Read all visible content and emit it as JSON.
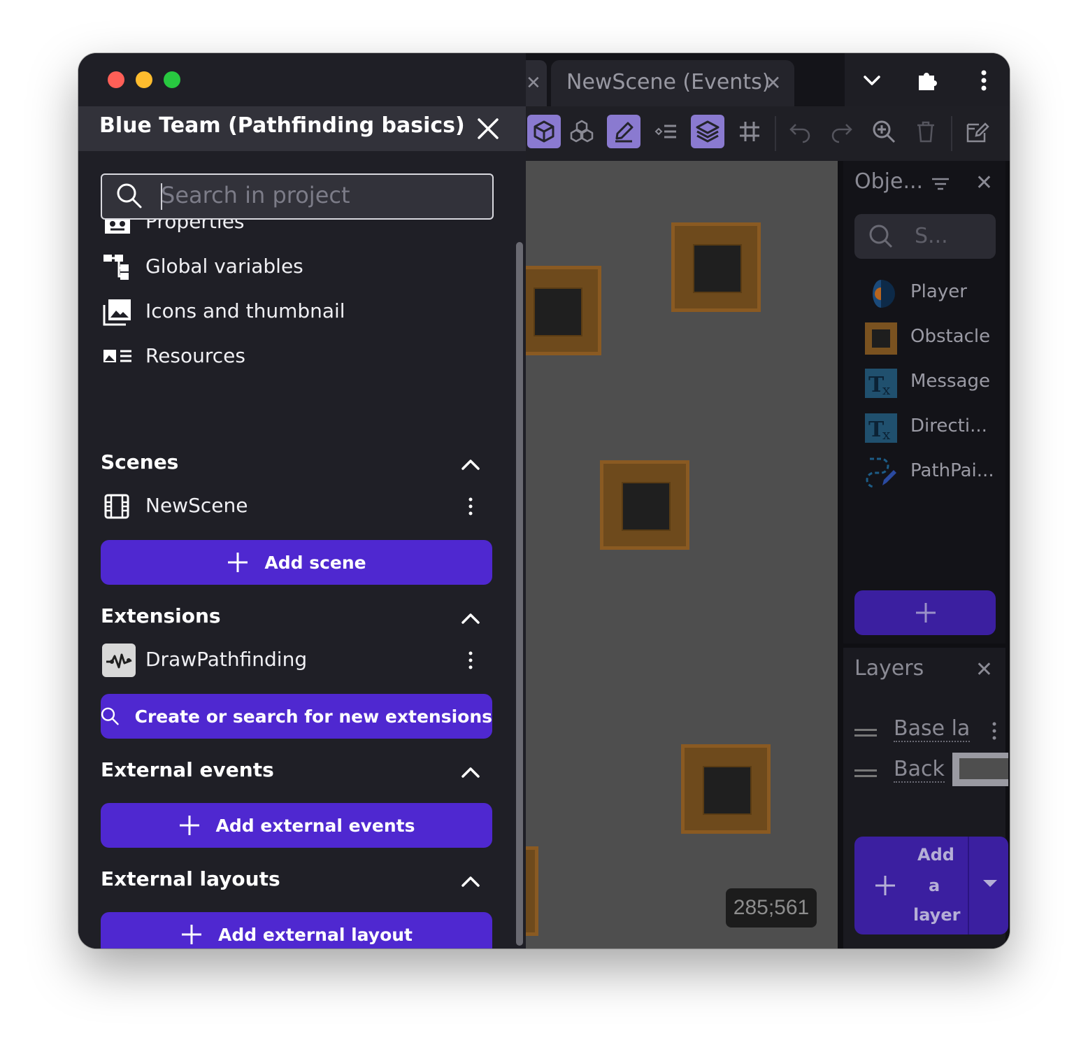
{
  "window": {
    "traffic_lights": {
      "close": "#ff5f57",
      "minimize": "#febc2e",
      "maximize": "#28c840"
    }
  },
  "editor": {
    "tab": {
      "label": "NewScene (Events)"
    },
    "coordinates": "285;561",
    "objects_panel": {
      "title": "Obje...",
      "search_placeholder": "S...",
      "items": [
        {
          "name": "Player",
          "icon": "player-sprite-icon"
        },
        {
          "name": "Obstacle",
          "icon": "crate-sprite-icon"
        },
        {
          "name": "Message",
          "icon": "text-object-icon"
        },
        {
          "name": "Directi...",
          "icon": "text-object-icon"
        },
        {
          "name": "PathPai...",
          "icon": "path-painter-icon"
        }
      ]
    },
    "layers_panel": {
      "title": "Layers",
      "layers": [
        {
          "name": "Base la"
        },
        {
          "name": "Back"
        }
      ],
      "add_layer_lines": [
        "Add",
        "a",
        "layer"
      ]
    }
  },
  "project_manager": {
    "title": "Blue Team (Pathfinding basics)",
    "search": {
      "placeholder": "Search in project"
    },
    "game_items": [
      {
        "label": "Properties",
        "icon": "properties-icon"
      },
      {
        "label": "Global variables",
        "icon": "variables-tree-icon"
      },
      {
        "label": "Icons and thumbnail",
        "icon": "image-gallery-icon"
      },
      {
        "label": "Resources",
        "icon": "resources-icon"
      }
    ],
    "scenes": {
      "heading": "Scenes",
      "items": [
        {
          "label": "NewScene",
          "icon": "film-scene-icon"
        }
      ],
      "add_label": "Add scene"
    },
    "extensions": {
      "heading": "Extensions",
      "items": [
        {
          "label": "DrawPathfinding",
          "icon": "extension-path-icon"
        }
      ],
      "add_label": "Create or search for new extensions"
    },
    "external_events": {
      "heading": "External events",
      "add_label": "Add external events"
    },
    "external_layouts": {
      "heading": "External layouts",
      "add_label": "Add external layout"
    }
  },
  "colors": {
    "accent": "#4f28d0",
    "drawer_bg": "#1f1f26",
    "canvas_bg": "#4e4e4e"
  }
}
